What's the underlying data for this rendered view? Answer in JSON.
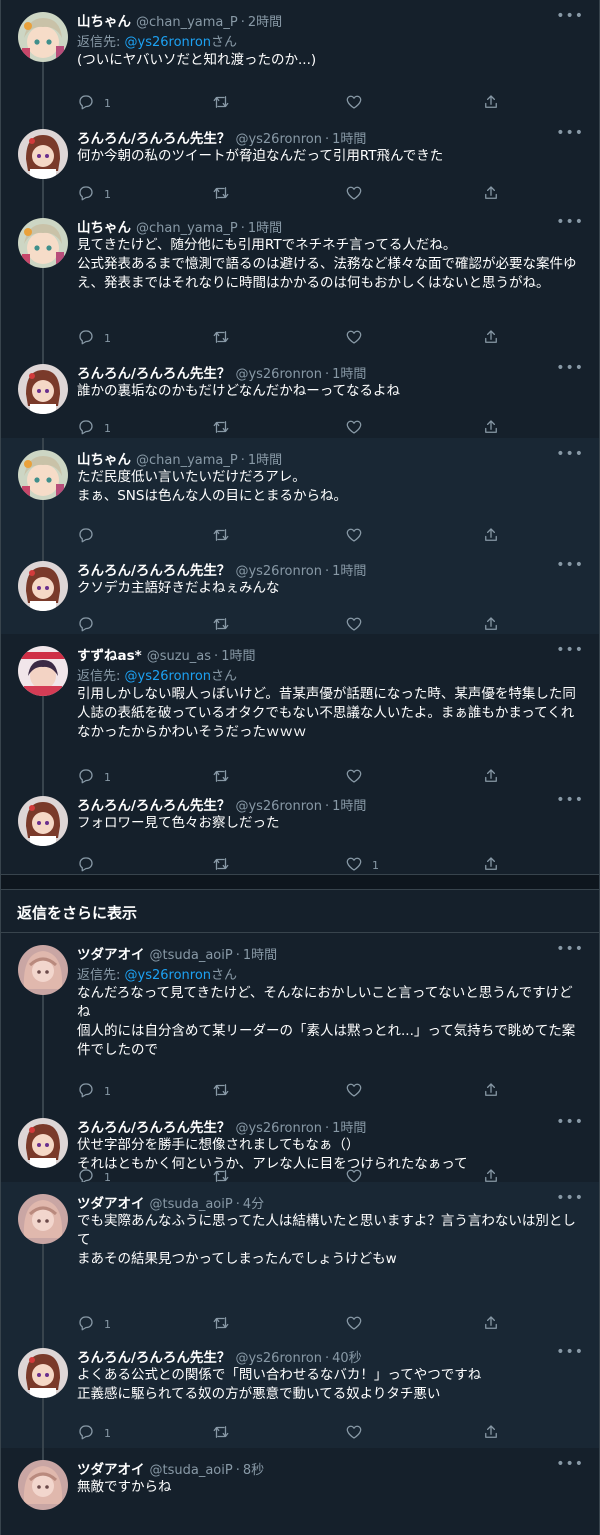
{
  "users": {
    "yama": {
      "name": "山ちゃん",
      "handle": "@chan_yama_P"
    },
    "ronron": {
      "name": "ろんろん/ろんろん先生？",
      "handle": "@ys26ronron"
    },
    "suzu": {
      "name": "すずねas*",
      "handle": "@suzu_as"
    },
    "tsuda": {
      "name": "ツダアオイ",
      "handle": "@tsuda_aoiP"
    }
  },
  "reply_prefix": "返信先: ",
  "reply_suffix": "さん",
  "tweets": [
    {
      "name": "山ちゃん",
      "handle": "@chan_yama_P",
      "time": "2時間",
      "reply_to": "@ys26ronron",
      "text": "(ついにヤバいソだと知れ渡ったのか...)",
      "replies": "1",
      "retweets": "",
      "likes": "",
      "more": "•••"
    },
    {
      "name": "ろんろん/ろんろん先生？",
      "handle": "@ys26ronron",
      "time": "1時間",
      "text": "何か今朝の私のツイートが脅迫なんだって引用RT飛んできた",
      "replies": "1",
      "retweets": "",
      "likes": "",
      "more": "•••"
    },
    {
      "name": "山ちゃん",
      "handle": "@chan_yama_P",
      "time": "1時間",
      "text": "見てきたけど、随分他にも引用RTでネチネチ言ってる人だね。\n公式発表あるまで憶測で語るのは避ける、法務など様々な面で確認が必要な案件ゆえ、発表まではそれなりに時間はかかるのは何もおかしくはないと思うがね。",
      "replies": "1",
      "retweets": "",
      "likes": "",
      "more": "•••"
    },
    {
      "name": "ろんろん/ろんろん先生？",
      "handle": "@ys26ronron",
      "time": "1時間",
      "text": "誰かの裏垢なのかもだけどなんだかねーってなるよね",
      "replies": "1",
      "retweets": "",
      "likes": "",
      "more": "•••"
    },
    {
      "name": "山ちゃん",
      "handle": "@chan_yama_P",
      "time": "1時間",
      "text": "ただ民度低い言いたいだけだろアレ。\nまぁ、SNSは色んな人の目にとまるからね。",
      "replies": "",
      "retweets": "",
      "likes": "",
      "more": "•••"
    },
    {
      "name": "ろんろん/ろんろん先生？",
      "handle": "@ys26ronron",
      "time": "1時間",
      "text": "クソデカ主語好きだよねぇみんな",
      "replies": "",
      "retweets": "",
      "likes": "",
      "more": "•••"
    },
    {
      "name": "すずねas*",
      "handle": "@suzu_as",
      "time": "1時間",
      "reply_to": "@ys26ronron",
      "text": "引用しかしない暇人っぽいけど。昔某声優が話題になった時、某声優を特集した同人誌の表紙を破っているオタクでもない不思議な人いたよ。まぁ誰もかまってくれなかったからかわいそうだったｗｗｗ",
      "replies": "1",
      "retweets": "",
      "likes": "",
      "more": "•••"
    },
    {
      "name": "ろんろん/ろんろん先生？",
      "handle": "@ys26ronron",
      "time": "1時間",
      "text": "フォロワー見て色々お察しだった",
      "replies": "",
      "retweets": "",
      "likes": "1",
      "more": "•••"
    },
    {
      "name": "ツダアオイ",
      "handle": "@tsuda_aoiP",
      "time": "1時間",
      "reply_to": "@ys26ronron",
      "text": "なんだろなって見てきたけど、そんなにおかしいこと言ってないと思うんですけどね\n個人的には自分含めて某リーダーの「素人は黙っとれ...」って気持ちで眺めてた案件でしたので",
      "replies": "1",
      "retweets": "",
      "likes": "",
      "more": "•••"
    },
    {
      "name": "ろんろん/ろんろん先生？",
      "handle": "@ys26ronron",
      "time": "1時間",
      "text": "伏せ字部分を勝手に想像されましてもなぁ（）\nそれはともかく何というか、アレな人に目をつけられたなぁって",
      "replies": "1",
      "retweets": "",
      "likes": "",
      "more": "•••"
    },
    {
      "name": "ツダアオイ",
      "handle": "@tsuda_aoiP",
      "time": "4分",
      "text": "でも実際あんなふうに思ってた人は結構いたと思いますよ？言う言わないは別として\nまあその結果見つかってしまったんでしょうけどもw",
      "replies": "1",
      "retweets": "",
      "likes": "",
      "more": "•••"
    },
    {
      "name": "ろんろん/ろんろん先生？",
      "handle": "@ys26ronron",
      "time": "40秒",
      "text": "よくある公式との関係で「問い合わせるなバカ！」ってやつですね\n正義感に駆られてる奴の方が悪意で動いてる奴よりタチ悪い",
      "replies": "1",
      "retweets": "",
      "likes": "",
      "more": "•••"
    },
    {
      "name": "ツダアオイ",
      "handle": "@tsuda_aoiP",
      "time": "8秒",
      "text": "無敵ですからね",
      "replies": "",
      "retweets": "",
      "likes": "",
      "more": "•••"
    }
  ],
  "show_more_label": "返信をさらに表示",
  "icons": {
    "reply": "reply-icon",
    "retweet": "retweet-icon",
    "like": "heart-icon",
    "share": "share-icon",
    "more": "more-icon"
  },
  "colors": {
    "background": "#15202b",
    "highlight": "#192734",
    "link": "#1da1f2",
    "muted": "#8899a6",
    "border": "#38444d"
  }
}
